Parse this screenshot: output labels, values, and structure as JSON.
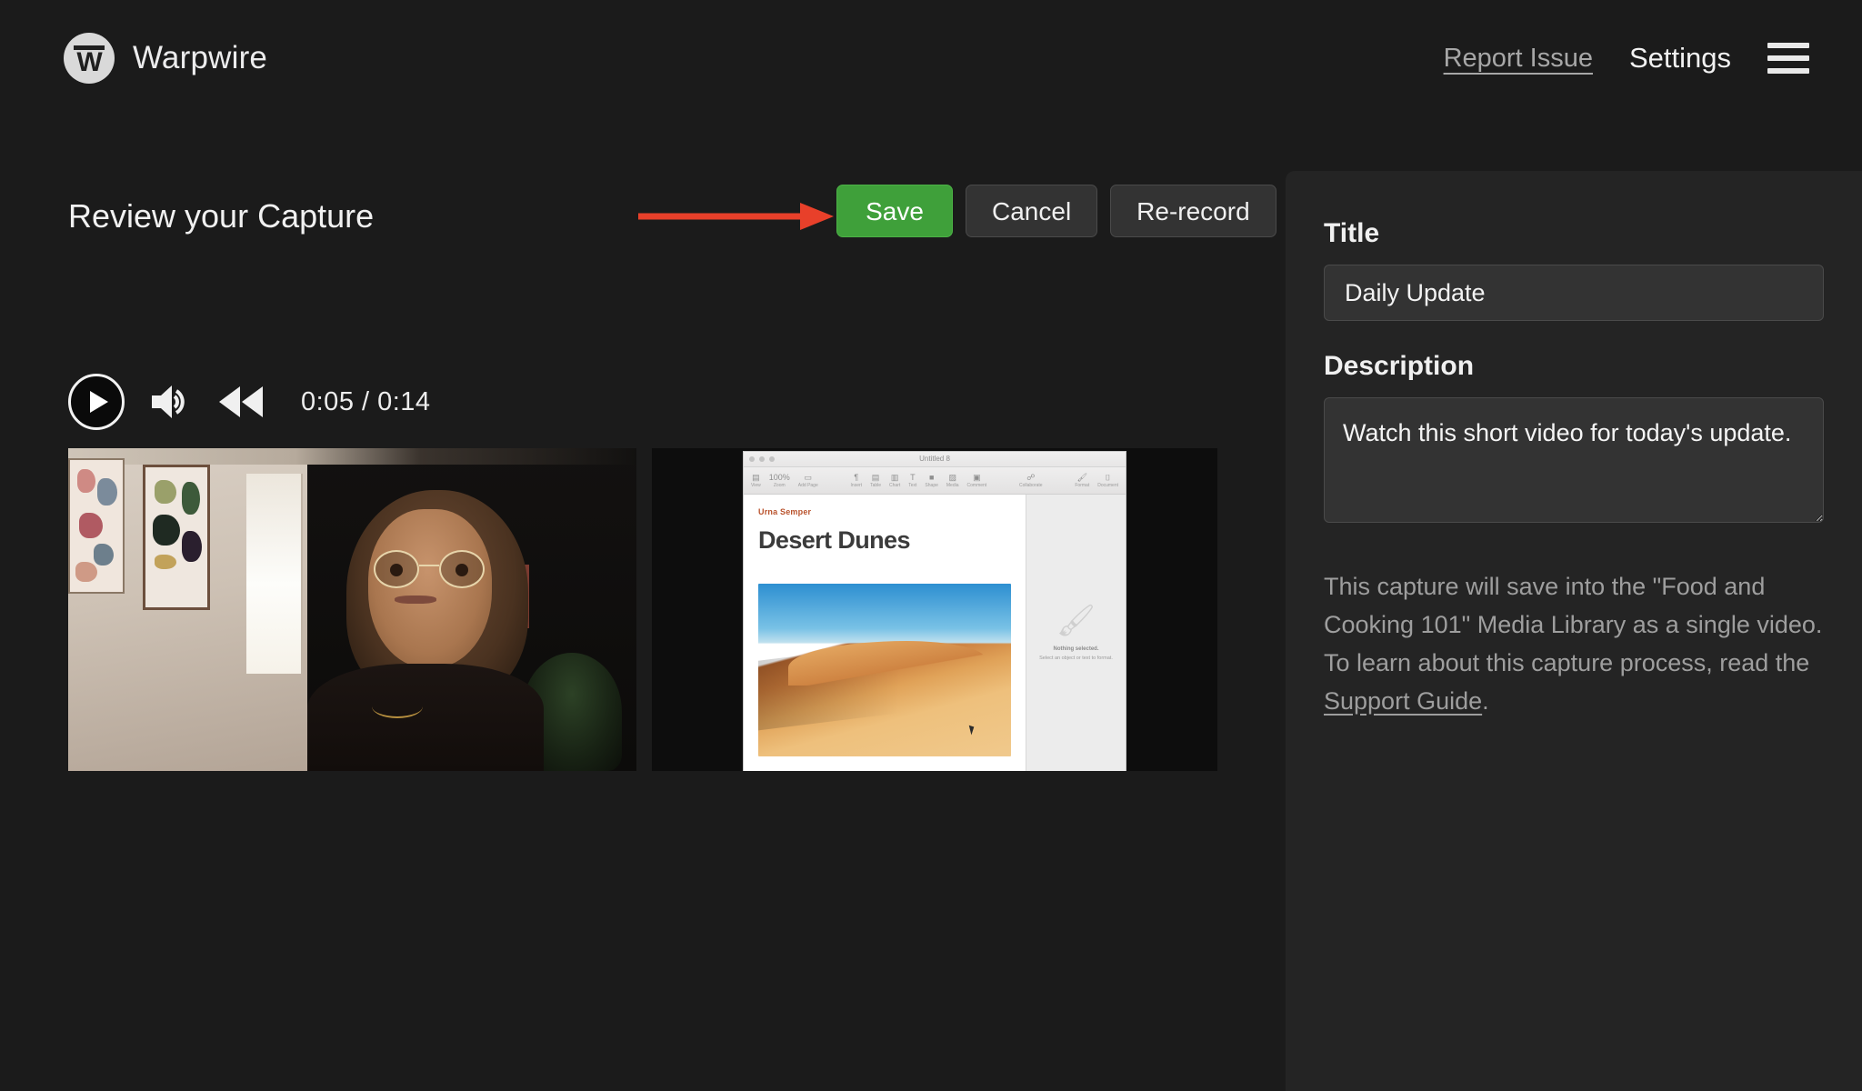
{
  "header": {
    "brand_name": "Warpwire",
    "brand_mark_letter": "W",
    "logo_icon": "warpwire-circle-w-logo",
    "report_issue_label": "Report Issue",
    "settings_label": "Settings",
    "menu_icon": "hamburger-menu-icon"
  },
  "main": {
    "page_title": "Review your Capture",
    "annotation": {
      "type": "arrow",
      "direction": "right",
      "color": "#e8402a",
      "points_to": "save-button"
    },
    "buttons": {
      "save_label": "Save",
      "cancel_label": "Cancel",
      "rerecord_label": "Re-record",
      "save_color": "#3fa03a"
    },
    "player": {
      "play_icon": "play-icon",
      "volume_icon": "volume-icon",
      "rewind_icon": "rewind-icon",
      "current_time": "0:05",
      "duration": "0:14",
      "time_display": "0:05 / 0:14"
    },
    "thumbnails": {
      "webcam": {
        "name": "webcam-preview",
        "alt": "Person wearing glasses seated in a room with framed wall art and a window"
      },
      "screen": {
        "name": "screen-share-preview",
        "alt": "macOS Pages document being shared"
      }
    }
  },
  "shared_document": {
    "window_title": "Untitled 8",
    "eyebrow": "Urna Semper",
    "heading": "Desert Dunes",
    "zoom_label": "100%",
    "toolbar_items": [
      "View",
      "Zoom",
      "Add Page",
      "Insert",
      "Table",
      "Chart",
      "Text",
      "Shape",
      "Media",
      "Comment",
      "Collaborate",
      "Format",
      "Document"
    ],
    "inspector_title": "Nothing selected.",
    "inspector_subtitle": "Select an object or text to format.",
    "photo_alt": "Sand dunes under a blue sky"
  },
  "sidebar": {
    "title_label": "Title",
    "title_value": "Daily Update",
    "title_placeholder": "Title",
    "description_label": "Description",
    "description_value": "Watch this short video for today's update.",
    "description_placeholder": "Description",
    "info_part1": "This capture will save into the \"Food and Cooking 101\" Media Library as a single video. To learn about this capture process, read the ",
    "info_link": "Support Guide",
    "info_part2": ".",
    "library_name": "Food and Cooking 101"
  }
}
